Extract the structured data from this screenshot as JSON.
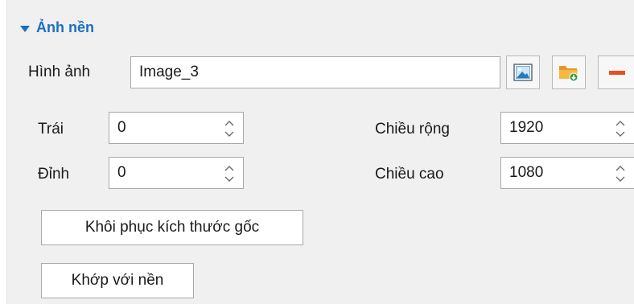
{
  "section": {
    "title": "Ảnh nền"
  },
  "image": {
    "label": "Hình ảnh",
    "value": "Image_3",
    "icons": [
      "image-preview-icon",
      "folder-open-icon",
      "remove-icon"
    ]
  },
  "position": {
    "left_label": "Trái",
    "left_value": "0",
    "top_label": "Đỉnh",
    "top_value": "0"
  },
  "size": {
    "width_label": "Chiều rộng",
    "width_value": "1920",
    "height_label": "Chiều cao",
    "height_value": "1080"
  },
  "buttons": {
    "restore_size": "Khôi phục kích thước gốc",
    "fit_background": "Khớp với nền"
  },
  "colors": {
    "accent": "#1c6fc1",
    "remove": "#e8501f",
    "folder": "#f4a62a",
    "folder_badge": "#2e9b3a"
  }
}
